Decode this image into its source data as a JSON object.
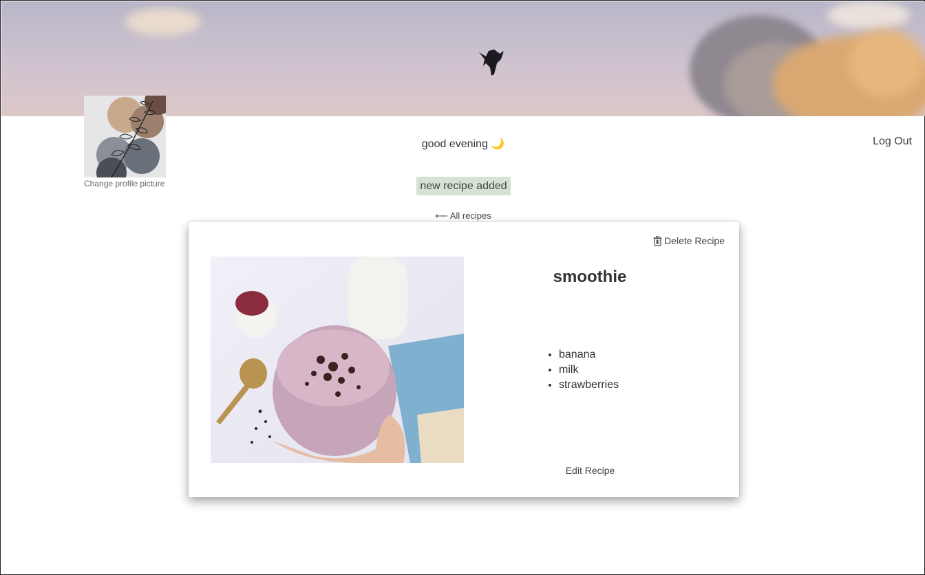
{
  "header": {
    "greeting": "good evening 🌙",
    "logout_label": "Log Out"
  },
  "profile": {
    "change_picture_label": "Change profile picture"
  },
  "alert": {
    "message": "new recipe added"
  },
  "nav": {
    "back_label": "⟵ All recipes"
  },
  "recipe": {
    "title": "smoothie",
    "delete_label": "Delete Recipe",
    "edit_label": "Edit Recipe",
    "ingredients": [
      "banana",
      "milk",
      "strawberries"
    ]
  },
  "icons": {
    "delete": "trash-icon",
    "back": "arrow-left-icon"
  },
  "colors": {
    "alert_background": "#d7e3d2",
    "text": "#333333"
  }
}
